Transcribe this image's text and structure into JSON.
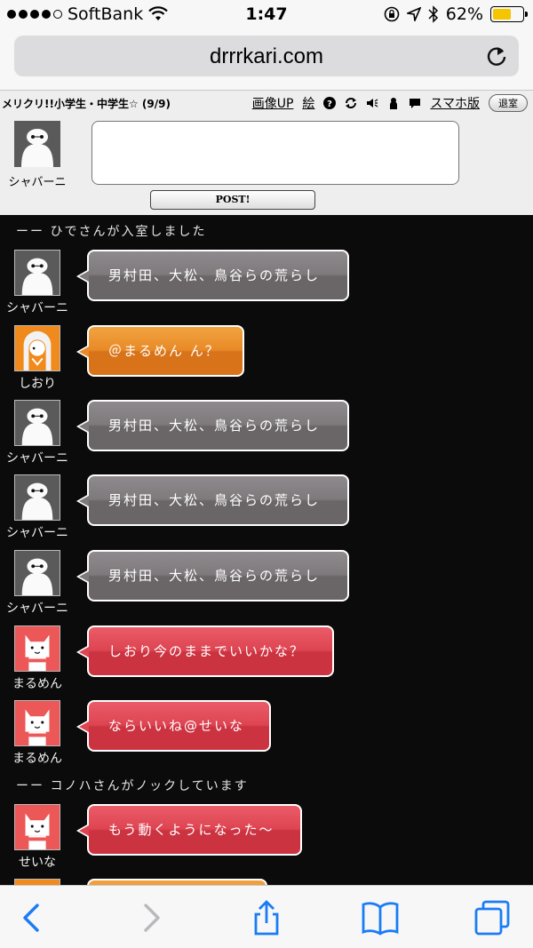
{
  "status_bar": {
    "carrier": "SoftBank",
    "time": "1:47",
    "battery": "62%",
    "battery_level": 0.62
  },
  "browser": {
    "url": "drrrkari.com"
  },
  "room": {
    "title": "メリクリ!!小学生・中学生☆ (9/9)",
    "menu": {
      "upload": "画像UP",
      "draw": "絵",
      "smartphone": "スマホ版",
      "exit": "退室"
    },
    "self_name": "シャバーニ",
    "post_label": "POST!"
  },
  "chat": {
    "system_1": "ーー ひでさんが入室しました",
    "system_2": "ーー コノハさんがノックしています",
    "messages": [
      {
        "user": "シャバーニ",
        "text": "男村田、大松、鳥谷らの荒らし",
        "color": "gray"
      },
      {
        "user": "しおり",
        "text": "＠まるめん ん？",
        "color": "orange"
      },
      {
        "user": "シャバーニ",
        "text": "男村田、大松、鳥谷らの荒らし",
        "color": "gray"
      },
      {
        "user": "シャバーニ",
        "text": "男村田、大松、鳥谷らの荒らし",
        "color": "gray"
      },
      {
        "user": "シャバーニ",
        "text": "男村田、大松、鳥谷らの荒らし",
        "color": "gray"
      },
      {
        "user": "まるめん",
        "text": "しおり今のままでいいかな？",
        "color": "red"
      },
      {
        "user": "まるめん",
        "text": "ならいいね@せいな",
        "color": "red"
      },
      {
        "user": "せいな",
        "text": "もう動くようになった～",
        "color": "red"
      }
    ]
  },
  "colors": {
    "gray_bubble": "#7e7a7c",
    "orange_bubble": "#e88a27",
    "red_bubble": "#de4452",
    "ios_blue": "#1a7cf5"
  }
}
